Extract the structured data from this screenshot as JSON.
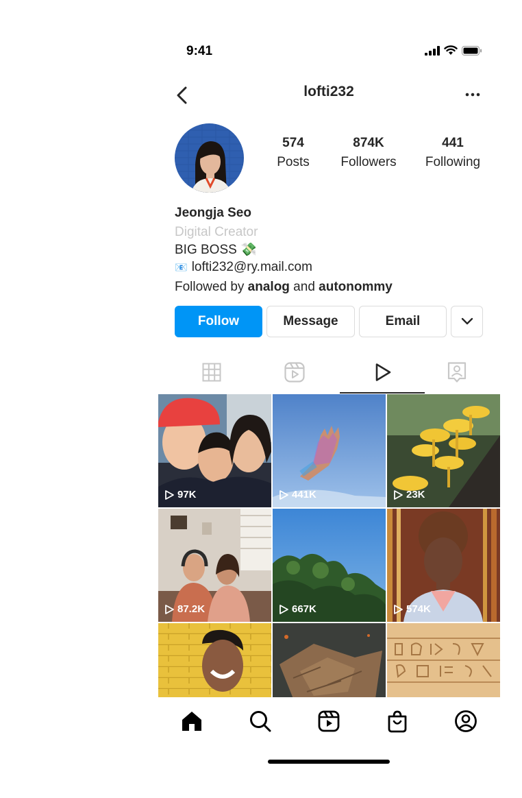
{
  "status_bar": {
    "time": "9:41",
    "icons": [
      "signal-icon",
      "wifi-icon",
      "battery-icon"
    ]
  },
  "nav": {
    "title": "lofti232",
    "back_icon": "chevron-left-icon",
    "more_icon": "ellipsis-icon"
  },
  "profile": {
    "stats": [
      {
        "value": "574",
        "label": "Posts"
      },
      {
        "value": "874K",
        "label": "Followers"
      },
      {
        "value": "441",
        "label": "Following"
      }
    ],
    "name": "Jeongja Seo",
    "category": "Digital Creator",
    "bio": "BIG BOSS 💸",
    "email_emoji": "📧",
    "email": "lofti232@ry.mail.com",
    "followed_by": {
      "prefix": "Followed by ",
      "user1": "analog",
      "middle": " and ",
      "user2": "autonommy"
    }
  },
  "actions": {
    "follow": "Follow",
    "message": "Message",
    "email": "Email",
    "more_icon": "chevron-down-icon",
    "accent": "#0095f6"
  },
  "tabs": [
    {
      "icon": "grid-icon",
      "active": false
    },
    {
      "icon": "reels-icon",
      "active": false
    },
    {
      "icon": "play-icon",
      "active": true
    },
    {
      "icon": "tagged-icon",
      "active": false
    }
  ],
  "grid": [
    {
      "views": "97K"
    },
    {
      "views": "441K"
    },
    {
      "views": "23K"
    },
    {
      "views": "87.2K"
    },
    {
      "views": "667K"
    },
    {
      "views": "574K"
    },
    {
      "views": ""
    },
    {
      "views": ""
    },
    {
      "views": ""
    }
  ],
  "tab_bar": [
    "home-icon",
    "search-icon",
    "reels-icon",
    "shop-icon",
    "profile-icon"
  ]
}
